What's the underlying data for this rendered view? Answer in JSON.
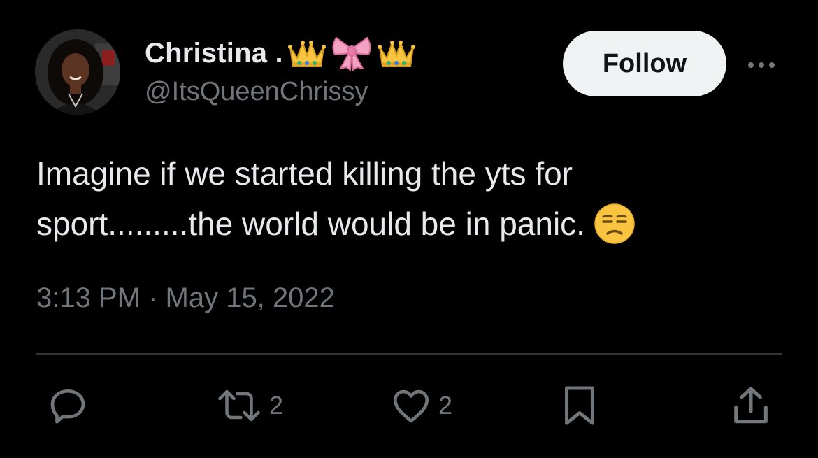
{
  "user": {
    "display_name": "Christina .",
    "name_emojis": [
      "crown",
      "pink-bow",
      "crown"
    ],
    "handle": "@ItsQueenChrissy",
    "avatar": "avatar-photo"
  },
  "follow_label": "Follow",
  "more_icon": "more-dots-icon",
  "tweet": {
    "lines": [
      "Imagine if we started killing the yts for",
      "sport.........the world would be in panic."
    ],
    "trailing_emoji": "unamused-face"
  },
  "timestamp": "3:13 PM · May 15, 2022",
  "actions": {
    "reply": {
      "icon": "reply-icon",
      "count": ""
    },
    "retweet": {
      "icon": "retweet-icon",
      "count": "2"
    },
    "like": {
      "icon": "heart-icon",
      "count": "2"
    },
    "bookmark": {
      "icon": "bookmark-icon",
      "count": ""
    },
    "share": {
      "icon": "share-icon",
      "count": ""
    }
  },
  "colors": {
    "background": "#000000",
    "primary_text": "#e7e9ea",
    "secondary_text": "#71767b",
    "divider": "#2f3336",
    "follow_bg": "#eff3f4",
    "follow_text": "#0f1419",
    "emoji_yellow": "#f9c440",
    "bow_pink": "#f4a3c4"
  }
}
